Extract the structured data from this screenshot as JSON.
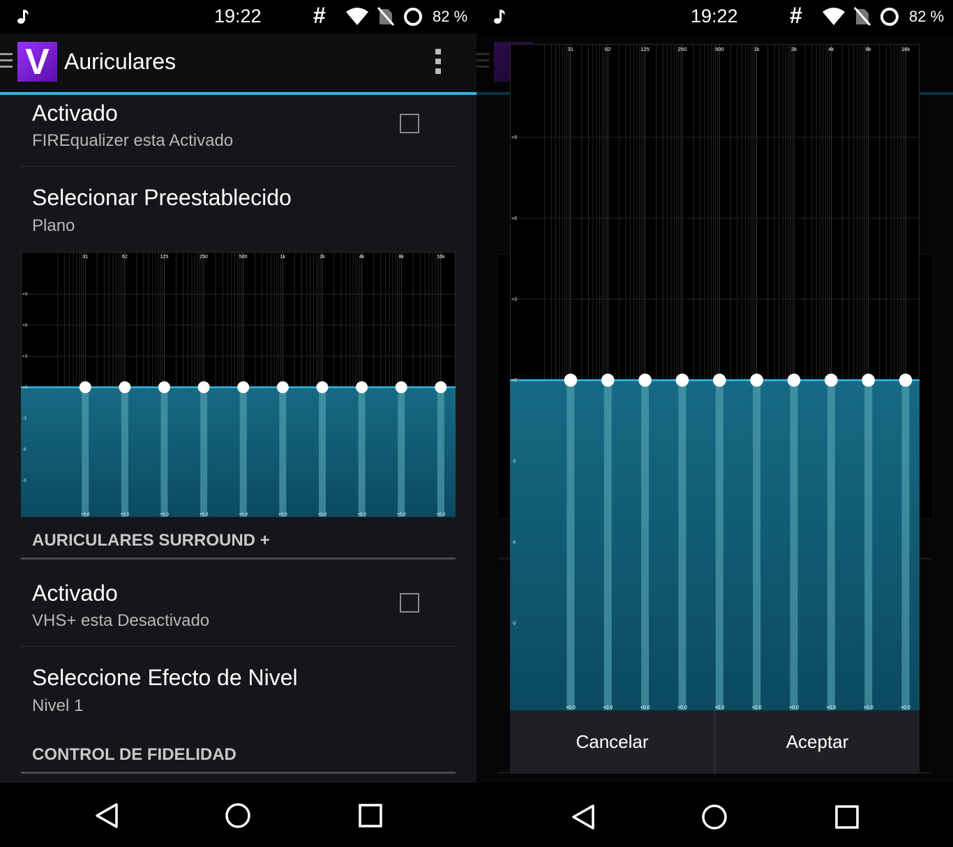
{
  "status": {
    "time": "19:22",
    "battery": "82 %",
    "hash": "#"
  },
  "app": {
    "title": "Auriculares",
    "logo_letter": "V"
  },
  "prefs": {
    "fire_enabled_title": "Activado",
    "fire_enabled_summary": "FIREqualizer esta Activado",
    "preset_title": "Selecionar Preestablecido",
    "preset_value": "Plano",
    "surround_header": "AURICULARES SURROUND +",
    "vhs_enabled_title": "Activado",
    "vhs_enabled_summary": "VHS+ esta Desactivado",
    "level_title": "Seleccione Efecto de Nivel",
    "level_value": "Nivel 1",
    "fidelity_header": "CONTROL DE FIDELIDAD"
  },
  "equalizer": {
    "bands": [
      "31",
      "62",
      "125",
      "250",
      "500",
      "1k",
      "2k",
      "4k",
      "8k",
      "16k"
    ],
    "gains_db": [
      0,
      0,
      0,
      0,
      0,
      0,
      0,
      0,
      0,
      0
    ],
    "gain_labels": [
      "+0.0",
      "+0.0",
      "+0.0",
      "+0.0",
      "+0.0",
      "+0.0",
      "+0.0",
      "+0.0",
      "+0.0",
      "+0.0"
    ],
    "y_ticks": [
      "+9",
      "+6",
      "+3",
      "+0",
      "-3",
      "-6",
      "-9"
    ],
    "y_tick_values": [
      9,
      6,
      3,
      0,
      -3,
      -6,
      -9
    ],
    "range_db": [
      -12,
      12
    ],
    "colors": {
      "fill": "#0f5f78",
      "line": "#33b5e5",
      "thumb": "#ffffff",
      "bar": "#5aa9b8"
    }
  },
  "dialog": {
    "cancel": "Cancelar",
    "accept": "Aceptar"
  }
}
